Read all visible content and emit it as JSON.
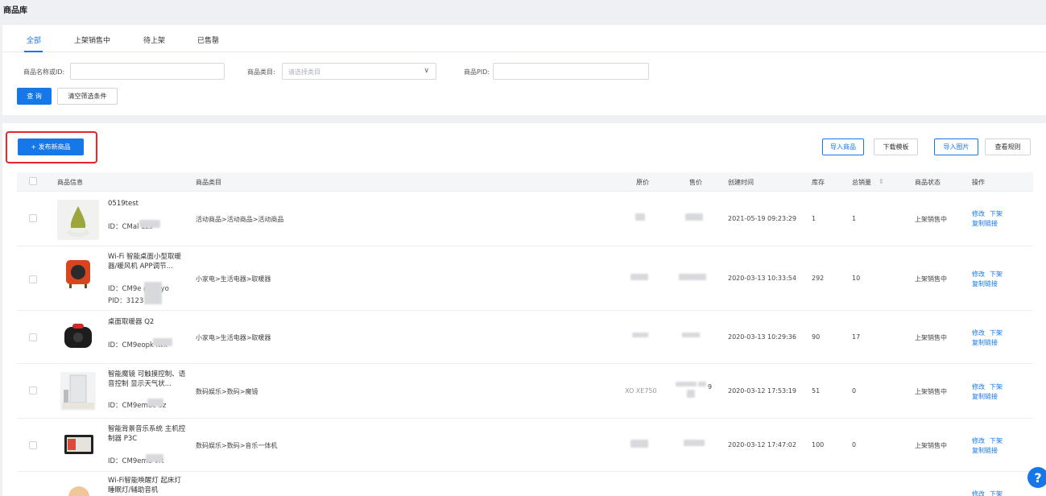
{
  "page": {
    "title": "商品库"
  },
  "tabs": [
    {
      "label": "全部",
      "active": true
    },
    {
      "label": "上架销售中"
    },
    {
      "label": "待上架"
    },
    {
      "label": "已售罄"
    }
  ],
  "filters": {
    "name_label": "商品名称或ID:",
    "name_value": "",
    "category_label": "商品类目:",
    "category_placeholder": "请选择类目",
    "pid_label": "商品PID:",
    "pid_value": "",
    "query_button": "查 询",
    "clear_button": "清空筛选条件"
  },
  "toolbar": {
    "publish_button": "+ 发布新商品",
    "import_goods": "导入商品",
    "download_template": "下载模板",
    "import_image": "导入图片",
    "view_rules": "查看规则"
  },
  "table": {
    "headers": {
      "info": "商品信息",
      "category": "商品类目",
      "original_price": "原价",
      "price": "售价",
      "created": "创建时间",
      "stock": "库存",
      "sales": "总销量",
      "status": "商品状态",
      "actions": "操作"
    },
    "rows": [
      {
        "name": "0519test",
        "id": "ID：CMal          1zs",
        "category": "活动商品>活动商品>活动商品",
        "created": "2021-05-19 09:23:29",
        "stock": "1",
        "sales": "1",
        "status": "上架销售中",
        "edit": "修改",
        "offshelf": "下架",
        "copy": "复制链接"
      },
      {
        "name": "Wi-Fi 智能桌面小型取暖器/暖风机 APP调节...",
        "id": "ID：CM9e         gon7yo",
        "pid": "PID：3123",
        "category": "小家电>生活电器>取暖器",
        "created": "2020-03-13 10:33:54",
        "stock": "292",
        "sales": "10",
        "status": "上架销售中",
        "edit": "修改",
        "offshelf": "下架",
        "copy": "复制链接"
      },
      {
        "name": "桌面取暖器 Q2",
        "id": "ID：CM9eopk         iwx",
        "category": "小家电>生活电器>取暖器",
        "created": "2020-03-13 10:29:36",
        "stock": "90",
        "sales": "17",
        "status": "上架销售中",
        "edit": "修改",
        "offshelf": "下架",
        "copy": "复制链接"
      },
      {
        "name": "智能魔镜 可触摸控制、语音控制 显示天气状...",
        "id": "ID：CM9em8c         9z",
        "category": "数码娱乐>数码>魔镜",
        "original_price": "XO  XE750",
        "price_suffix": "9",
        "created": "2020-03-12 17:53:19",
        "stock": "51",
        "sales": "0",
        "status": "上架销售中",
        "edit": "修改",
        "offshelf": "下架",
        "copy": "复制链接"
      },
      {
        "name": "智能背景音乐系统 主机控制器 P3C",
        "id": "ID：CM9em8         vrt",
        "category": "数码娱乐>数码>音乐一体机",
        "created": "2020-03-12 17:47:02",
        "stock": "100",
        "sales": "0",
        "status": "上架销售中",
        "edit": "修改",
        "offshelf": "下架",
        "copy": "复制链接"
      },
      {
        "name": "Wi-Fi智能唤醒灯 起床灯 睡眠灯/辅助音机",
        "edit": "修改",
        "offshelf": "下架"
      }
    ]
  },
  "help": {
    "label": "?"
  },
  "colors": {
    "accent": "#1677e8",
    "highlight": "#e5262b"
  }
}
